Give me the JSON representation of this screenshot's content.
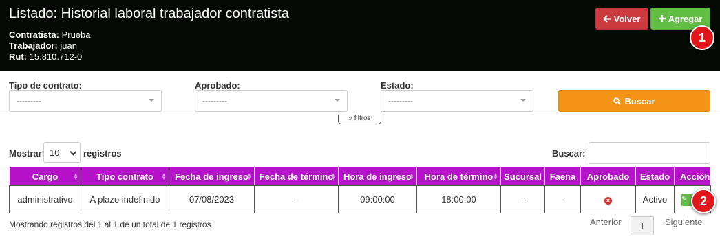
{
  "header": {
    "title": "Listado: Historial laboral trabajador contratista",
    "contratista_label": "Contratista:",
    "contratista_value": "Prueba",
    "trabajador_label": "Trabajador:",
    "trabajador_value": "juan",
    "rut_label": "Rut:",
    "rut_value": "15.810.712-0",
    "back_label": "Volver",
    "add_label": "Agregar",
    "back_icon": "arrow-left-icon",
    "add_icon": "plus-icon"
  },
  "filters": {
    "tipo_label": "Tipo de contrato:",
    "tipo_value": "---------",
    "aprobado_label": "Aprobado:",
    "aprobado_value": "---------",
    "estado_label": "Estado:",
    "estado_value": "---------",
    "search_button": "Buscar",
    "toggle_label": "filtros"
  },
  "table_controls": {
    "show_label": "Mostrar",
    "length_value": "10",
    "records_label": "registros",
    "search_label": "Buscar:"
  },
  "table": {
    "columns": [
      "Cargo",
      "Tipo contrato",
      "Fecha de ingreso",
      "Fecha de término",
      "Hora de ingreso",
      "Hora de término",
      "Sucursal",
      "Faena",
      "Aprobado",
      "Estado",
      "Acción"
    ],
    "rows": [
      {
        "cargo": "administrativo",
        "tipo": "A plazo indefinido",
        "fecha_ingreso": "07/08/2023",
        "fecha_termino": "-",
        "hora_ingreso": "09:00:00",
        "hora_termino": "18:00:00",
        "sucursal": "-",
        "faena": "-",
        "aprobado_icon": "x-circle-icon",
        "estado": "Activo",
        "action_icon": "pencil-icon"
      }
    ]
  },
  "footer": {
    "info": "Mostrando registros del 1 al 1 de un total de 1 registros",
    "prev": "Anterior",
    "page": "1",
    "next": "Siguiente"
  },
  "badges": {
    "one": "1",
    "two": "2"
  },
  "colors": {
    "header_bg": "#030a03",
    "back_button": "#cb3a3f",
    "add_button": "#62bd45",
    "search_button": "#f39417",
    "table_header": "#b512c9",
    "badge": "#e0161b"
  }
}
